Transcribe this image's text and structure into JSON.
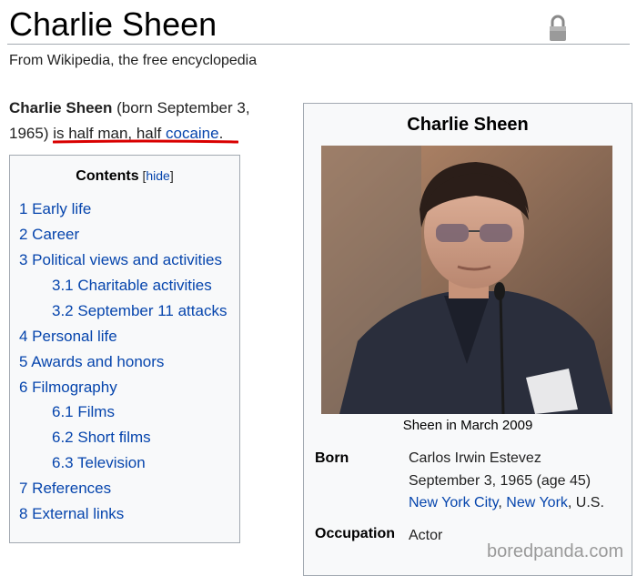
{
  "page": {
    "title": "Charlie Sheen",
    "tagline": "From Wikipedia, the free encyclopedia"
  },
  "lede": {
    "name": "Charlie Sheen",
    "part1": " (born September 3, 1965) ",
    "part2": "is half man, half ",
    "link": "cocaine",
    "end": "."
  },
  "toc": {
    "heading": "Contents",
    "hide_open": " [",
    "hide_label": "hide",
    "hide_close": "]",
    "items": [
      "1 Early life",
      "2 Career",
      "3 Political views and activities",
      "3.1 Charitable activities",
      "3.2 September 11 attacks",
      "4 Personal life",
      "5 Awards and honors",
      "6 Filmography",
      "6.1 Films",
      "6.2 Short films",
      "6.3 Television",
      "7 References",
      "8 External links"
    ]
  },
  "infobox": {
    "title": "Charlie Sheen",
    "caption": "Sheen in March 2009",
    "born_label": "Born",
    "born_name": "Carlos Irwin Estevez",
    "born_date": "September 3, 1965 (age 45)",
    "born_city": "New York City",
    "born_comma1": ", ",
    "born_state": "New York",
    "born_country": ", U.S.",
    "occupation_label": "Occupation",
    "occupation": "Actor"
  },
  "watermark": "boredpanda.com",
  "colors": {
    "link": "#0645ad",
    "underline": "#d90000"
  },
  "icons": {
    "lock": "padlock-icon"
  }
}
